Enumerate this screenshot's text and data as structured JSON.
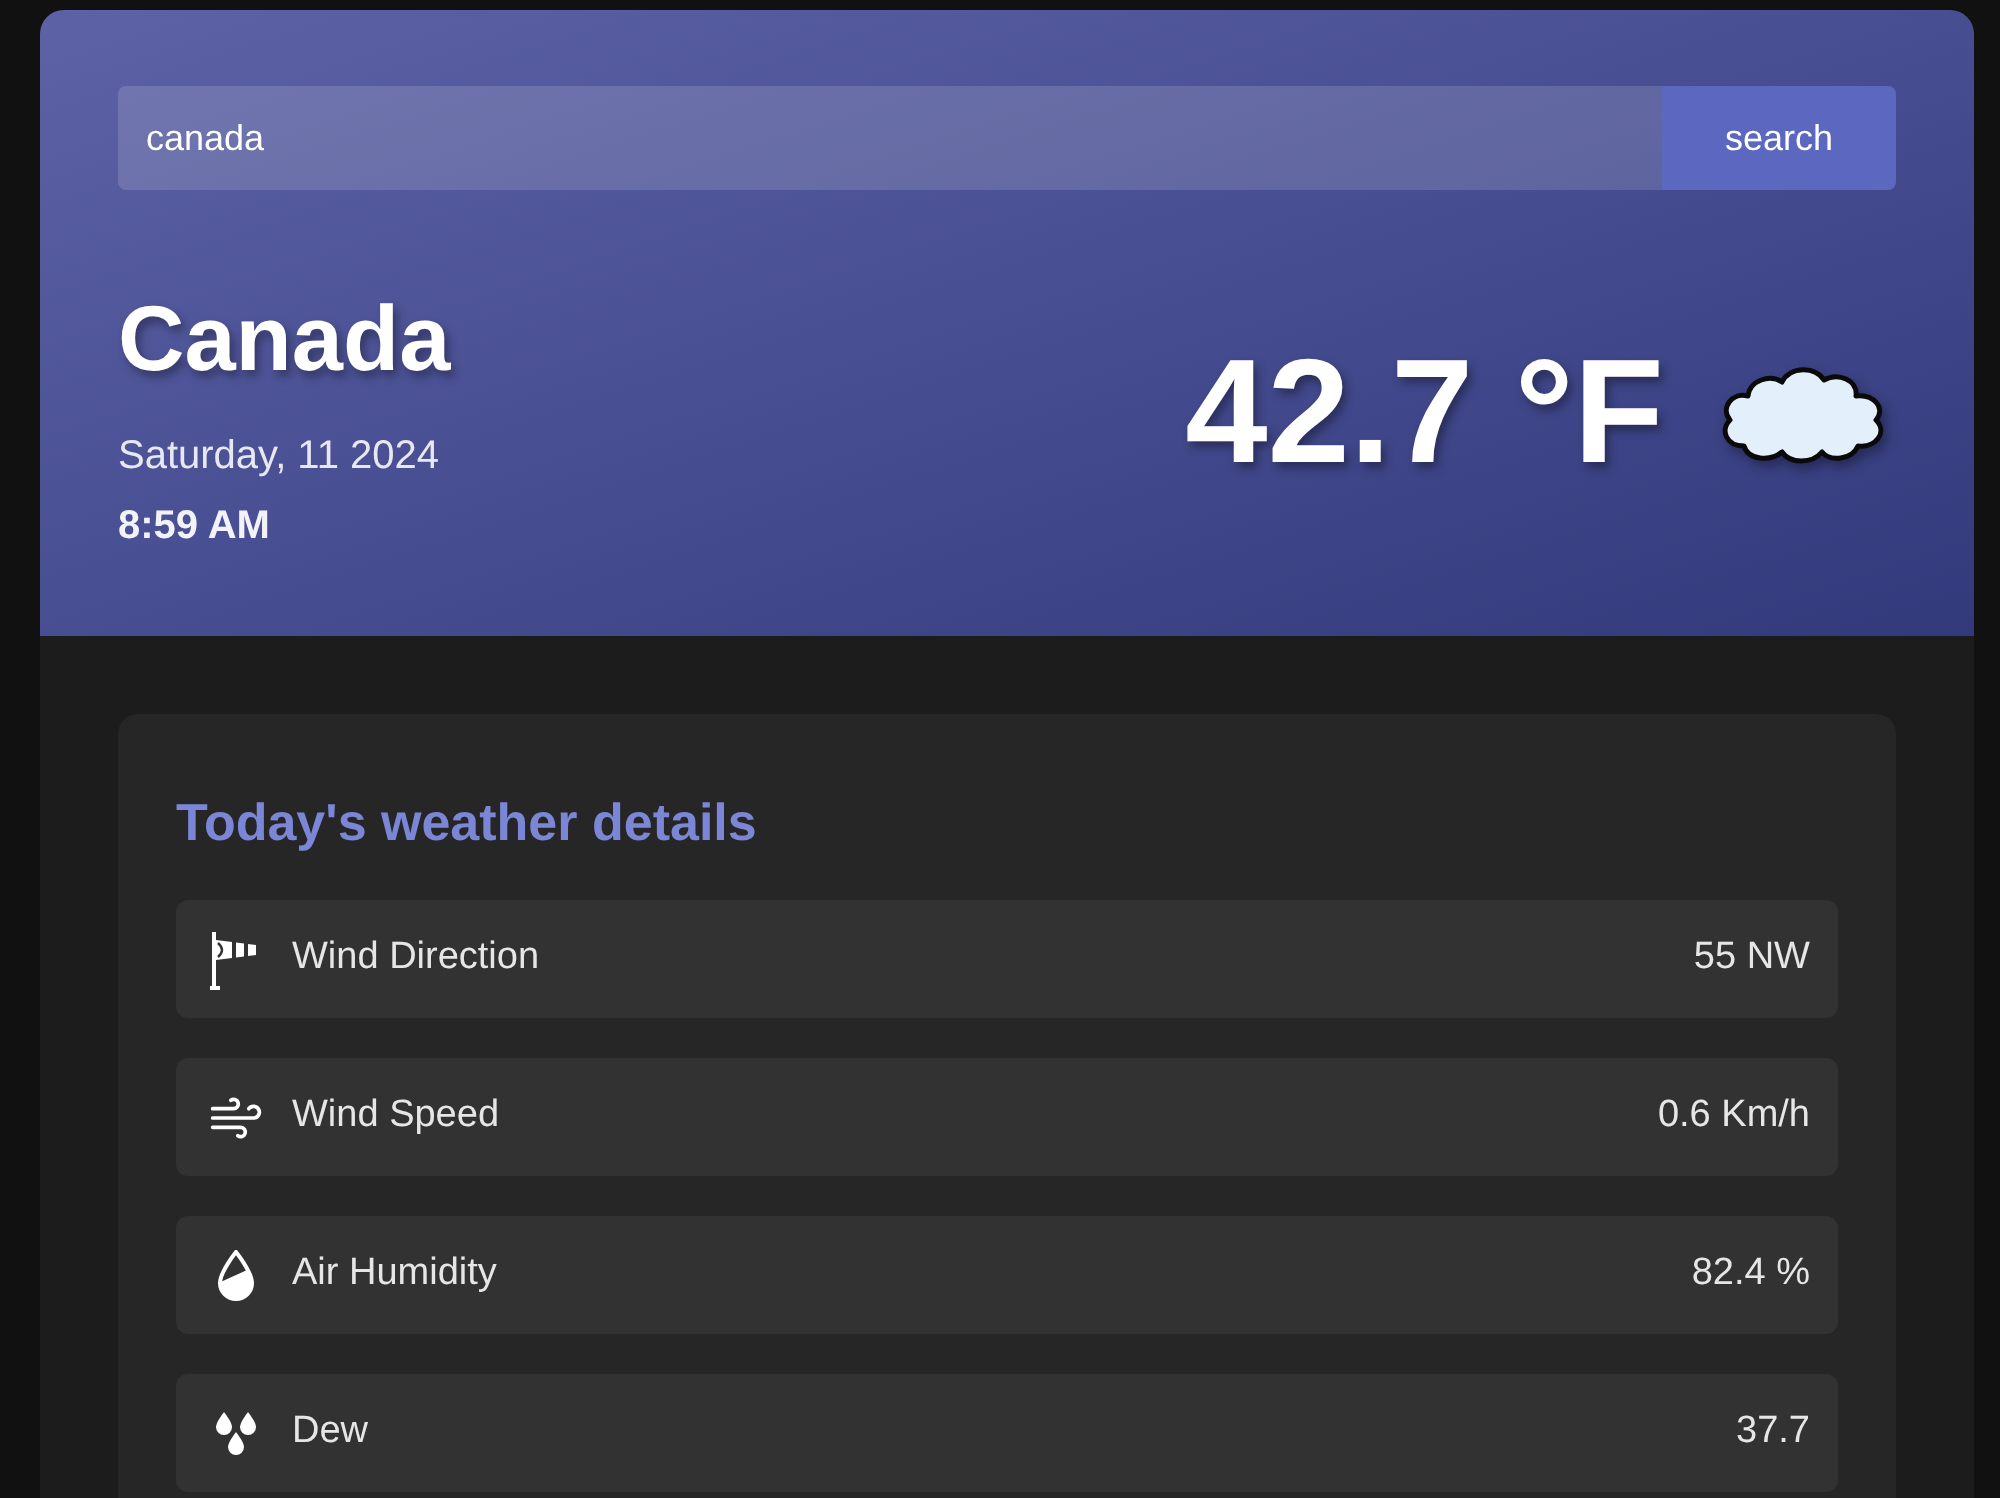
{
  "search": {
    "value": "canada",
    "button": "search"
  },
  "location": {
    "city": "Canada",
    "date": "Saturday, 11 2024",
    "time": "8:59 AM"
  },
  "current": {
    "temperature": "42.7 °F"
  },
  "details": {
    "title": "Today's weather details",
    "rows": [
      {
        "label": "Wind Direction",
        "value": "55 NW"
      },
      {
        "label": "Wind Speed",
        "value": "0.6 Km/h"
      },
      {
        "label": "Air Humidity",
        "value": "82.4 %"
      },
      {
        "label": "Dew",
        "value": "37.7"
      }
    ]
  }
}
